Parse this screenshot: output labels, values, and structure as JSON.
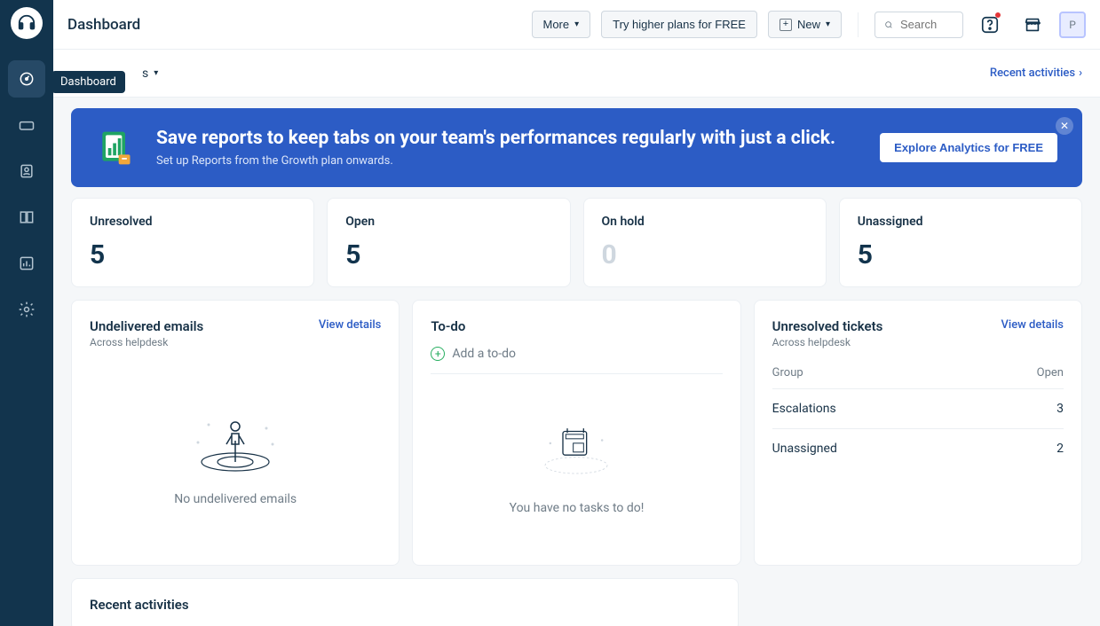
{
  "header": {
    "title": "Dashboard",
    "more_label": "More",
    "trial_label": "Try higher plans for FREE",
    "new_label": "New",
    "search_placeholder": "Search",
    "avatar_initial": "P"
  },
  "tooltip": "Dashboard",
  "subheader": {
    "dropdown_label": "s",
    "recent_link": "Recent activities"
  },
  "banner": {
    "title": "Save reports to keep tabs on your team's performances regularly with just a click.",
    "subtitle": "Set up Reports from the Growth plan onwards.",
    "cta": "Explore Analytics for FREE"
  },
  "stats": [
    {
      "label": "Unresolved",
      "value": "5",
      "muted": false
    },
    {
      "label": "Open",
      "value": "5",
      "muted": false
    },
    {
      "label": "On hold",
      "value": "0",
      "muted": true
    },
    {
      "label": "Unassigned",
      "value": "5",
      "muted": false
    }
  ],
  "undelivered": {
    "title": "Undelivered emails",
    "subtitle": "Across helpdesk",
    "link": "View details",
    "empty": "No undelivered emails"
  },
  "todo": {
    "title": "To-do",
    "add_label": "Add a to-do",
    "empty": "You have no tasks to do!"
  },
  "tickets": {
    "title": "Unresolved tickets",
    "subtitle": "Across helpdesk",
    "link": "View details",
    "col_group": "Group",
    "col_open": "Open",
    "rows": [
      {
        "group": "Escalations",
        "open": "3"
      },
      {
        "group": "Unassigned",
        "open": "2"
      }
    ]
  },
  "recent": {
    "title": "Recent activities"
  }
}
